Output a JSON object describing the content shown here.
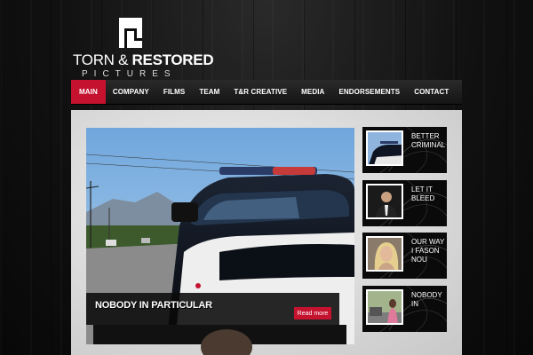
{
  "brand": {
    "line1_light": "TORN &",
    "line1_bold": " RESTORED",
    "line2": "PICTURES"
  },
  "nav": {
    "items": [
      {
        "label": "MAIN",
        "active": true
      },
      {
        "label": "COMPANY",
        "active": false
      },
      {
        "label": "FILMS",
        "active": false
      },
      {
        "label": "TEAM",
        "active": false
      },
      {
        "label": "T&R CREATIVE",
        "active": false
      },
      {
        "label": "MEDIA",
        "active": false
      },
      {
        "label": "ENDORSEMENTS",
        "active": false
      },
      {
        "label": "CONTACT",
        "active": false
      }
    ]
  },
  "hero": {
    "title": "NOBODY IN PARTICULAR",
    "read_more": "Read more"
  },
  "sidebar": {
    "films": [
      {
        "title": "BETTER CRIMINAL",
        "image": "police-car-thumbnail"
      },
      {
        "title": "LET IT BLEED",
        "image": "man-in-suit-thumbnail"
      },
      {
        "title": "OUR WAY I FASON NOU",
        "image": "blonde-woman-thumbnail"
      },
      {
        "title": "NOBODY IN",
        "image": "woman-on-street-thumbnail"
      }
    ]
  },
  "colors": {
    "accent": "#c4122f",
    "nav_bg": "#1e1e1e",
    "panel_bg": "#dcdcdc",
    "page_bg": "#0c0c0c"
  }
}
